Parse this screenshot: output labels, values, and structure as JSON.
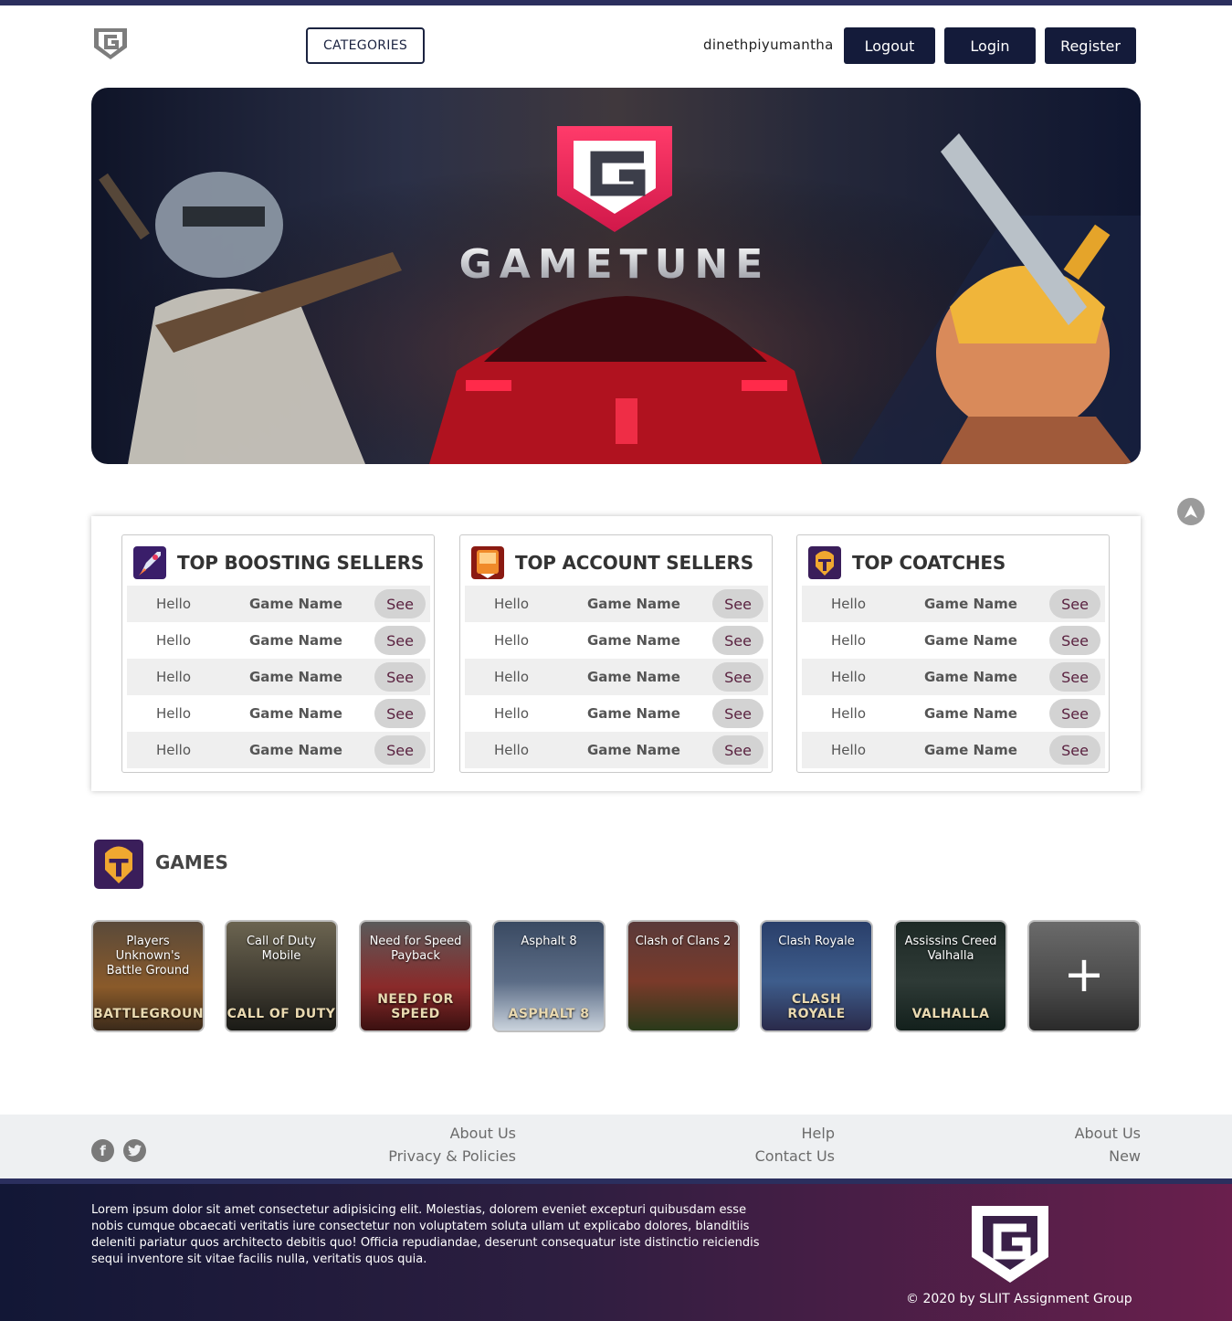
{
  "header": {
    "categories_label": "CATEGORIES",
    "username": "dinethpiyumantha",
    "logout_label": "Logout",
    "login_label": "Login",
    "register_label": "Register"
  },
  "hero": {
    "brand": "GAMETUNE"
  },
  "sellers": {
    "cards": [
      {
        "title": "TOP BOOSTING SELLERS",
        "rows": [
          {
            "col1": "Hello",
            "col2": "Game Name",
            "action": "See"
          },
          {
            "col1": "Hello",
            "col2": "Game Name",
            "action": "See"
          },
          {
            "col1": "Hello",
            "col2": "Game Name",
            "action": "See"
          },
          {
            "col1": "Hello",
            "col2": "Game Name",
            "action": "See"
          },
          {
            "col1": "Hello",
            "col2": "Game Name",
            "action": "See"
          }
        ]
      },
      {
        "title": "TOP ACCOUNT SELLERS",
        "rows": [
          {
            "col1": "Hello",
            "col2": "Game Name",
            "action": "See"
          },
          {
            "col1": "Hello",
            "col2": "Game Name",
            "action": "See"
          },
          {
            "col1": "Hello",
            "col2": "Game Name",
            "action": "See"
          },
          {
            "col1": "Hello",
            "col2": "Game Name",
            "action": "See"
          },
          {
            "col1": "Hello",
            "col2": "Game Name",
            "action": "See"
          }
        ]
      },
      {
        "title": "TOP COATCHES",
        "rows": [
          {
            "col1": "Hello",
            "col2": "Game Name",
            "action": "See"
          },
          {
            "col1": "Hello",
            "col2": "Game Name",
            "action": "See"
          },
          {
            "col1": "Hello",
            "col2": "Game Name",
            "action": "See"
          },
          {
            "col1": "Hello",
            "col2": "Game Name",
            "action": "See"
          },
          {
            "col1": "Hello",
            "col2": "Game Name",
            "action": "See"
          }
        ]
      }
    ]
  },
  "games": {
    "title": "GAMES",
    "items": [
      {
        "name": "Players Unknown's Battle Ground",
        "art": "BATTLEGROUNDS",
        "color": "#8a5a2a"
      },
      {
        "name": "Call of Duty Mobile",
        "art": "CALL OF DUTY",
        "color": "#3e3a30"
      },
      {
        "name": "Need for Speed Payback",
        "art": "NEED FOR SPEED",
        "color": "#8a2a2a"
      },
      {
        "name": "Asphalt 8",
        "art": "ASPHALT 8",
        "color": "#5b6c86"
      },
      {
        "name": "Clash of Clans 2",
        "art": "",
        "color": "#7a3a2a"
      },
      {
        "name": "Clash Royale",
        "art": "CLASH ROYALE",
        "color": "#3e5d8c"
      },
      {
        "name": "Assissins Creed Valhalla",
        "art": "VALHALLA",
        "color": "#2e3a36"
      }
    ],
    "more_label": "+"
  },
  "footer": {
    "col1": [
      "About Us",
      "Privacy & Policies"
    ],
    "col2": [
      "Help",
      "Contact Us"
    ],
    "col3": [
      "About Us",
      "New"
    ],
    "social": [
      "facebook-icon",
      "twitter-icon"
    ],
    "lorem": "Lorem ipsum dolor sit amet consectetur adipisicing elit. Molestias, dolorem eveniet excepturi quibusdam esse nobis cumque obcaecati veritatis iure consectetur non voluptatem soluta ullam ut explicabo dolores, blanditiis deleniti pariatur quos architecto debitis quo! Officia repudiandae, deserunt consequatur iste distinctio reiciendis sequi inventore sit vitae facilis nulla, veritatis quos quia.",
    "copyright": "© 2020 by SLIIT Assignment Group"
  },
  "colors": {
    "navy": "#141b3a",
    "accent": "#e8365d",
    "see_text": "#5a2240"
  }
}
